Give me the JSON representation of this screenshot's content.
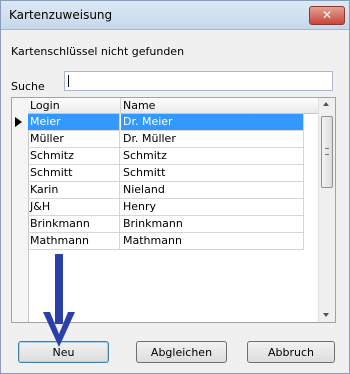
{
  "window": {
    "title": "Kartenzuweisung",
    "close_glyph": "✕"
  },
  "message": "Kartenschlüssel nicht gefunden",
  "search": {
    "label": "Suche",
    "value": ""
  },
  "grid": {
    "columns": [
      "Login",
      "Name"
    ],
    "rows": [
      {
        "login": "Meier",
        "name": "Dr. Meier",
        "selected": true
      },
      {
        "login": "Müller",
        "name": "Dr. Müller"
      },
      {
        "login": "Schmitz",
        "name": "Schmitz"
      },
      {
        "login": "Schmitt",
        "name": "Schmitt"
      },
      {
        "login": "Karin",
        "name": "Nieland"
      },
      {
        "login": "J&H",
        "name": "Henry"
      },
      {
        "login": "Brinkmann",
        "name": "Brinkmann"
      },
      {
        "login": "Mathmann",
        "name": "Mathmann"
      }
    ]
  },
  "buttons": {
    "neu": "Neu",
    "abgleichen": "Abgleichen",
    "abbruch": "Abbruch"
  },
  "colors": {
    "selection": "#3399ff",
    "arrow": "#2b3fa8"
  },
  "icons": {
    "row_marker": "current-row-arrow-icon",
    "annotation": "down-arrow-annotation-icon"
  }
}
